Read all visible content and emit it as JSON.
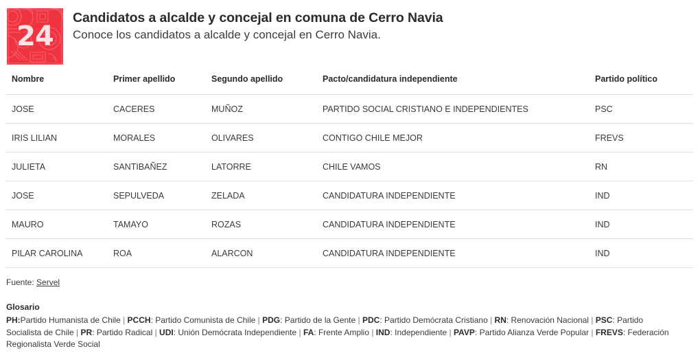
{
  "brand": {
    "logo_number": "24",
    "logo_color": "#ef3340",
    "logo_number_color": "#fde3e4"
  },
  "header": {
    "title": "Candidatos a alcalde y concejal en comuna de Cerro Navia",
    "subtitle": "Conoce los candidatos a alcalde y concejal en Cerro Navia."
  },
  "table": {
    "columns": [
      "Nombre",
      "Primer apellido",
      "Segundo apellido",
      "Pacto/candidatura independiente",
      "Partido político"
    ],
    "rows": [
      {
        "nombre": "JOSE",
        "primer_apellido": "CACERES",
        "segundo_apellido": "MUÑOZ",
        "pacto": "PARTIDO SOCIAL CRISTIANO E INDEPENDIENTES",
        "partido": "PSC"
      },
      {
        "nombre": "IRIS LILIAN",
        "primer_apellido": "MORALES",
        "segundo_apellido": "OLIVARES",
        "pacto": "CONTIGO CHILE MEJOR",
        "partido": "FREVS"
      },
      {
        "nombre": "JULIETA",
        "primer_apellido": "SANTIBAÑEZ",
        "segundo_apellido": "LATORRE",
        "pacto": "CHILE VAMOS",
        "partido": "RN"
      },
      {
        "nombre": "JOSE",
        "primer_apellido": "SEPULVEDA",
        "segundo_apellido": "ZELADA",
        "pacto": "CANDIDATURA INDEPENDIENTE",
        "partido": "IND"
      },
      {
        "nombre": "MAURO",
        "primer_apellido": "TAMAYO",
        "segundo_apellido": "ROZAS",
        "pacto": "CANDIDATURA INDEPENDIENTE",
        "partido": "IND"
      },
      {
        "nombre": "PILAR CAROLINA",
        "primer_apellido": "ROA",
        "segundo_apellido": "ALARCON",
        "pacto": "CANDIDATURA INDEPENDIENTE",
        "partido": "IND"
      }
    ]
  },
  "source": {
    "label": "Fuente:",
    "link_text": "Servel"
  },
  "glossary": {
    "title": "Glosario",
    "separator": "|",
    "entries": [
      {
        "abbr": "PH:",
        "desc": "Partido Humanista de Chile"
      },
      {
        "abbr": "PCCH",
        "desc": ": Partido Comunista de Chile"
      },
      {
        "abbr": "PDG",
        "desc": ": Partido de la Gente"
      },
      {
        "abbr": "PDC",
        "desc": ": Partido Demócrata Cristiano"
      },
      {
        "abbr": "RN",
        "desc": ": Renovación Nacional"
      },
      {
        "abbr": "PSC",
        "desc": ": Partido Socialista de Chile"
      },
      {
        "abbr": "PR",
        "desc": ": Partido Radical"
      },
      {
        "abbr": "UDI",
        "desc": ": Unión Demócrata Independiente"
      },
      {
        "abbr": "FA",
        "desc": ": Frente Amplio"
      },
      {
        "abbr": "IND",
        "desc": ": Independiente"
      },
      {
        "abbr": "PAVP",
        "desc": ": Partido Alianza Verde Popular"
      },
      {
        "abbr": "FREVS",
        "desc": ": Federación Regionalista Verde Social"
      }
    ]
  }
}
